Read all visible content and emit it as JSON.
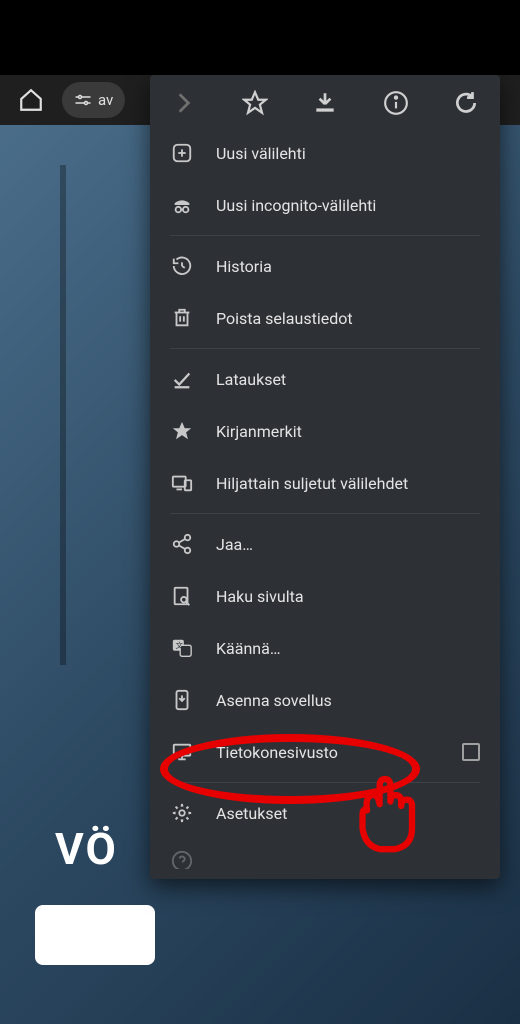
{
  "topbar": {
    "url_prefix": "av"
  },
  "page": {
    "title_fragment": "VÖ"
  },
  "menu": {
    "items": [
      {
        "icon": "plus-box",
        "label": "Uusi välilehti"
      },
      {
        "icon": "incognito",
        "label": "Uusi incognito-välilehti"
      },
      {
        "divider": true
      },
      {
        "icon": "history",
        "label": "Historia"
      },
      {
        "icon": "trash",
        "label": "Poista selaustiedot"
      },
      {
        "divider": true
      },
      {
        "icon": "download-check",
        "label": "Lataukset"
      },
      {
        "icon": "star-filled",
        "label": "Kirjanmerkit"
      },
      {
        "icon": "devices",
        "label": "Hiljattain suljetut välilehdet"
      },
      {
        "divider": true
      },
      {
        "icon": "share",
        "label": "Jaa…"
      },
      {
        "icon": "find-page",
        "label": "Haku sivulta"
      },
      {
        "icon": "translate",
        "label": "Käännä…"
      },
      {
        "icon": "install",
        "label": "Asenna sovellus"
      },
      {
        "icon": "desktop",
        "label": "Tietokonesivusto",
        "checkbox": true
      },
      {
        "divider": true
      },
      {
        "icon": "gear",
        "label": "Asetukset"
      },
      {
        "icon": "help",
        "label": "",
        "cutoff": true
      }
    ]
  }
}
